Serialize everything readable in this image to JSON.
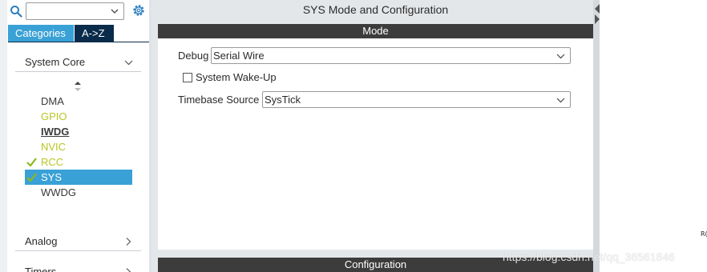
{
  "left": {
    "search_value": "",
    "tabs": {
      "categories": "Categories",
      "az": "A->Z"
    },
    "sections": {
      "system_core": "System Core",
      "analog": "Analog",
      "timers": "Timers"
    },
    "items": [
      {
        "label": "DMA",
        "state": "normal",
        "checked": false,
        "selected": false
      },
      {
        "label": "GPIO",
        "state": "yellow",
        "checked": false,
        "selected": false
      },
      {
        "label": "IWDG",
        "state": "bold",
        "checked": false,
        "selected": false
      },
      {
        "label": "NVIC",
        "state": "yellow",
        "checked": false,
        "selected": false
      },
      {
        "label": "RCC",
        "state": "yellow",
        "checked": true,
        "selected": false
      },
      {
        "label": "SYS",
        "state": "selected",
        "checked": true,
        "selected": true
      },
      {
        "label": "WWDG",
        "state": "normal",
        "checked": false,
        "selected": false
      }
    ]
  },
  "main": {
    "title": "SYS Mode and Configuration",
    "mode_header": "Mode",
    "config_header": "Configuration",
    "debug_label": "Debug",
    "debug_value": "Serial Wire",
    "wakeup_label": "System Wake-Up",
    "wakeup_checked": false,
    "timebase_label": "Timebase Source",
    "timebase_value": "SysTick"
  },
  "right": {
    "partial_text": "R("
  },
  "watermark": "https://blog.csdn.net/qq_36561846",
  "colors": {
    "accent": "#39a1d6",
    "tab_dark": "#0a2b4a",
    "yellow_item": "#b9c524",
    "check": "#8fb81d",
    "header_bar": "#3c3c3c"
  }
}
